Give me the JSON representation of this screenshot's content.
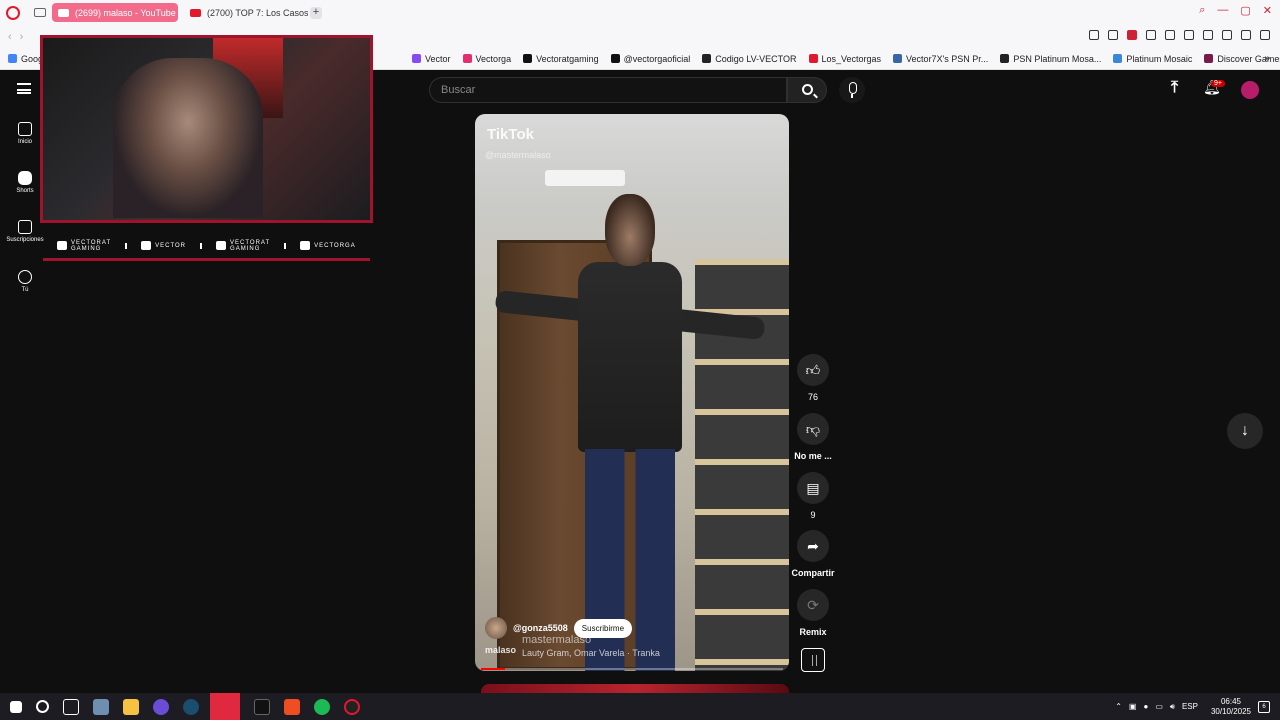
{
  "browser": {
    "tabs": [
      {
        "label": "(2699) malaso - YouTube",
        "active": true
      },
      {
        "label": "(2700) TOP 7: Los Casos",
        "active": false
      }
    ],
    "new_tab_symbol": "+",
    "bookmarks": [
      {
        "label": "Google",
        "color": "#4285f4"
      },
      {
        "label": "Vector",
        "color": "#8a4af3"
      },
      {
        "label": "Vectorga",
        "color": "#e1306c"
      },
      {
        "label": "Vectoratgaming",
        "color": "#111111"
      },
      {
        "label": "@vectorgaoficial",
        "color": "#111111"
      },
      {
        "label": "Codigo LV-VECTOR",
        "color": "#222222"
      },
      {
        "label": "Los_Vectorgas",
        "color": "#e2192c"
      },
      {
        "label": "Vector7X's PSN Pr...",
        "color": "#3a66a8"
      },
      {
        "label": "PSN Platinum Mosa...",
        "color": "#222222"
      },
      {
        "label": "Platinum Mosaic",
        "color": "#3a86d8"
      },
      {
        "label": "Discover Games -...",
        "color": "#7a1a4a"
      }
    ],
    "more_bookmarks": "»"
  },
  "youtube": {
    "search_placeholder": "Buscar",
    "notifications_badge": "9+",
    "sidebar": [
      {
        "label": "Inicio",
        "icon": "home-icon"
      },
      {
        "label": "Shorts",
        "icon": "shorts-icon"
      },
      {
        "label": "Suscripciones",
        "icon": "subscriptions-icon"
      },
      {
        "label": "Tú",
        "icon": "you-icon"
      }
    ],
    "short": {
      "watermark": "TikTok",
      "watermark_user": "@mastermalaso",
      "channel": "@gonza5508",
      "subscribe_label": "Suscribirme",
      "overlay_name": "mastermalaso",
      "overlay_user": "malaso",
      "song": "Lauty Gram, Omar Varela · Tranka",
      "progress": 0.08
    },
    "actions": {
      "likes": "76",
      "dislike_label": "No me ...",
      "comments": "9",
      "share_label": "Compartir",
      "remix_label": "Remix"
    }
  },
  "stream_overlay": {
    "socials": [
      {
        "line1": "VECTORAT",
        "line2": "GAMING",
        "icon": "youtube-icon"
      },
      {
        "line1": "VECTOR",
        "line2": "",
        "icon": "twitch-icon"
      },
      {
        "line1": "VECTORAT",
        "line2": "GAMING",
        "icon": "twitter-icon"
      },
      {
        "line1": "VECTORGA",
        "line2": "",
        "icon": "instagram-icon"
      }
    ]
  },
  "taskbar": {
    "language": "ESP",
    "time": "06:45",
    "date": "30/10/2025",
    "notifications": "6"
  }
}
